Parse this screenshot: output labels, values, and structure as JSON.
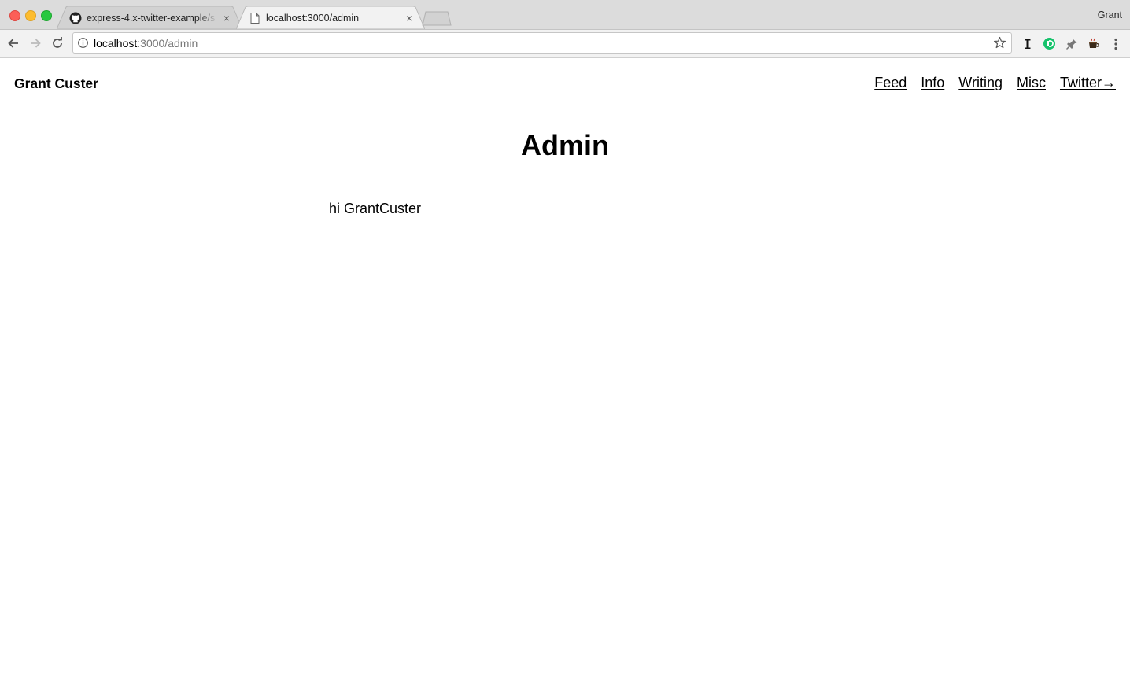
{
  "browser": {
    "tabs": [
      {
        "title": "express-4.x-twitter-example/s",
        "favicon": "github-icon",
        "active": false
      },
      {
        "title": "localhost:3000/admin",
        "favicon": "page-icon",
        "active": true
      }
    ],
    "profile_name": "Grant",
    "address_bar": {
      "host": "localhost",
      "path": ":3000/admin"
    },
    "toolbar_icons": [
      "back-arrow-icon",
      "forward-arrow-icon",
      "reload-icon",
      "info-icon",
      "star-icon",
      "instapaper-icon",
      "grammarly-icon",
      "pin-icon",
      "coffee-icon",
      "menu-dots-icon"
    ]
  },
  "site": {
    "title": "Grant Custer",
    "nav": [
      {
        "label": "Feed"
      },
      {
        "label": "Info"
      },
      {
        "label": "Writing"
      },
      {
        "label": "Misc"
      },
      {
        "label": "Twitter→"
      }
    ]
  },
  "main": {
    "heading": "Admin",
    "greeting": "hi GrantCuster"
  },
  "colors": {
    "tab_strip": "#dcdcdc",
    "toolbar": "#f2f2f2",
    "active_tab": "#f2f2f2",
    "inactive_tab": "#d0d0d0",
    "text": "#000000"
  }
}
